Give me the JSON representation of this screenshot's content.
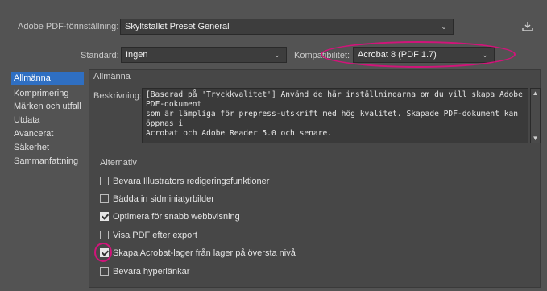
{
  "header": {
    "preset_label": "Adobe PDF-förinställning:",
    "preset_value": "Skyltstallet Preset General",
    "save_icon": "download-preset-icon"
  },
  "row2": {
    "standard_label": "Standard:",
    "standard_value": "Ingen",
    "compat_label": "Kompatibilitet:",
    "compat_value": "Acrobat 8 (PDF 1.7)"
  },
  "sidebar": {
    "items": [
      {
        "label": "Allmänna"
      },
      {
        "label": "Komprimering"
      },
      {
        "label": "Märken och utfall"
      },
      {
        "label": "Utdata"
      },
      {
        "label": "Avancerat"
      },
      {
        "label": "Säkerhet"
      },
      {
        "label": "Sammanfattning"
      }
    ]
  },
  "main": {
    "section_title": "Allmänna",
    "desc_label": "Beskrivning:",
    "description": "[Baserad på 'Tryckkvalitet'] Använd de här inställningarna om du vill skapa Adobe PDF-dokument\nsom är lämpliga för prepress-utskrift med hög kvalitet.  Skapade PDF-dokument kan öppnas i\nAcrobat och Adobe Reader 5.0 och senare.",
    "options_title": "Alternativ",
    "options": [
      {
        "label": "Bevara Illustrators redigeringsfunktioner",
        "checked": false
      },
      {
        "label": "Bädda in sidminiatyrbilder",
        "checked": false
      },
      {
        "label": "Optimera för snabb webbvisning",
        "checked": true
      },
      {
        "label": "Visa PDF efter export",
        "checked": false
      },
      {
        "label": "Skapa Acrobat-lager från lager på översta nivå",
        "checked": true
      },
      {
        "label": "Bevara hyperlänkar",
        "checked": false
      }
    ]
  },
  "colors": {
    "accent": "#2f6fc2",
    "annotation": "#d1147a"
  }
}
